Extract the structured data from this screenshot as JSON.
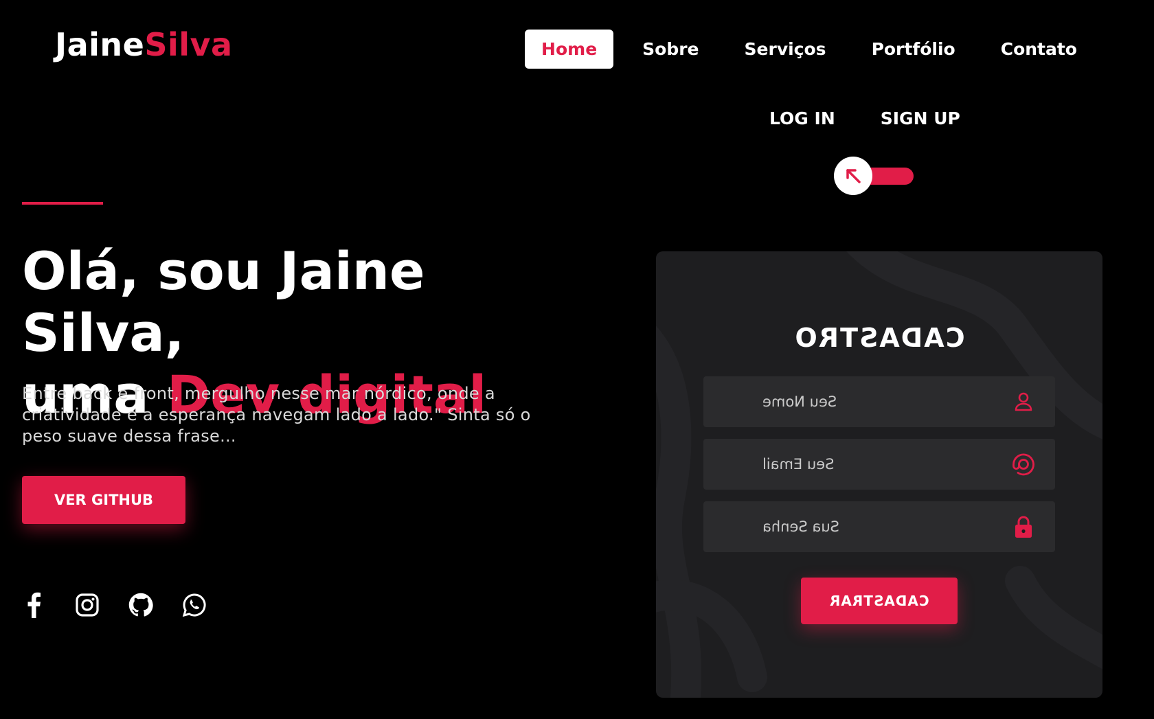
{
  "brand": {
    "first": "Jaine",
    "second": "Silva"
  },
  "colors": {
    "accent": "#e11d48",
    "background": "#000000",
    "card": "#1e1e20",
    "field": "#2b2b2d"
  },
  "nav": {
    "items": [
      {
        "label": "Home",
        "active": true
      },
      {
        "label": "Sobre"
      },
      {
        "label": "Serviços"
      },
      {
        "label": "Portfólio"
      },
      {
        "label": "Contato"
      }
    ]
  },
  "auth": {
    "login": "LOG IN",
    "signup": "SIGN UP"
  },
  "toggle": {
    "icon": "arrow-up-left-icon"
  },
  "hero": {
    "title_line1": "Olá, sou Jaine Silva,",
    "title_line2_prefix": "uma ",
    "title_line2_accent": "Dev digital",
    "text": "Entre back e front, mergulho nesse mar nórdico, onde a criatividade e a esperança navegam lado a lado.\" Sinta só o peso suave dessa frase...",
    "button": "VER GITHUB"
  },
  "socials": [
    "facebook-icon",
    "instagram-icon",
    "github-icon",
    "whatsapp-icon"
  ],
  "form": {
    "title": "CADASTRO",
    "fields": [
      {
        "placeholder": "Seu Nome",
        "icon": "user-icon"
      },
      {
        "placeholder": "Seu Email",
        "icon": "at-sign-icon"
      },
      {
        "placeholder": "Sua Senha",
        "icon": "lock-icon"
      }
    ],
    "submit": "CADASTRAR"
  }
}
